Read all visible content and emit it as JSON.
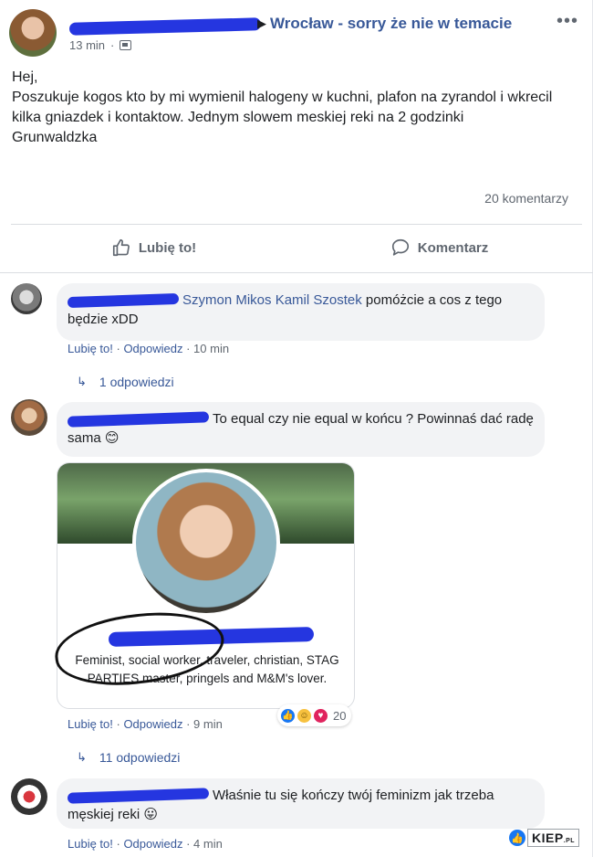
{
  "post": {
    "group_name": "Wrocław - sorry że nie w temacie",
    "time": "13 min",
    "text_lines": [
      "Hej,",
      "Poszukuje kogos kto by mi wymienil halogeny w kuchni, plafon na zyrandol i wkrecil kilka gniazdek i kontaktow. Jednym slowem meskiej reki na 2 godzinki",
      "Grunwaldzka"
    ],
    "comments_count": "20 komentarzy",
    "like_label": "Lubię to!",
    "comment_label": "Komentarz"
  },
  "comments": [
    {
      "mentions": "Szymon Mikos Kamil Szostek",
      "text": " pomóżcie a cos z tego będzie xDD",
      "like": "Lubię to!",
      "reply": "Odpowiedz",
      "time": "10 min",
      "replies": "1 odpowiedzi"
    },
    {
      "text": "To equal czy nie equal w końcu ? Powinnaś dać radę sama 😊",
      "card_bio": "Feminist, social worker, traveler, christian, STAG PARTIES master, pringels and M&M's lover.",
      "like": "Lubię to!",
      "reply": "Odpowiedz",
      "time": "9 min",
      "reaction_count": "20",
      "replies": "11 odpowiedzi"
    },
    {
      "text": "Właśnie tu się kończy twój feminizm jak trzeba męskiej reki 😛",
      "like": "Lubię to!",
      "reply": "Odpowiedz",
      "time": "4 min"
    }
  ],
  "watermark": {
    "text": "KIEP",
    "suffix": ".PL"
  },
  "colors": {
    "link": "#385898",
    "redaction": "#2536e0",
    "bubble": "#f2f3f5",
    "muted": "#606770"
  }
}
